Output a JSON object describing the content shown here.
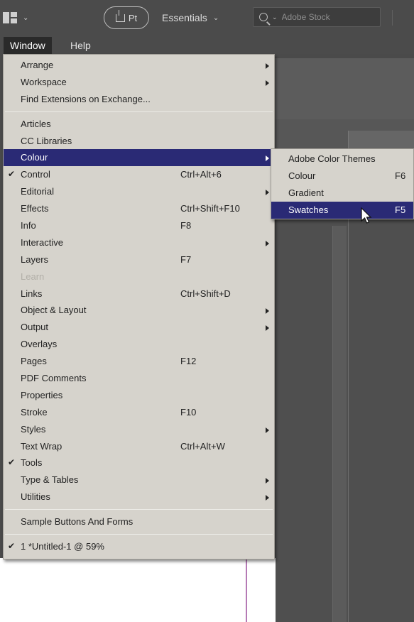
{
  "topbar": {
    "publish_label": "Pt",
    "workspace_label": "Essentials",
    "search_placeholder": "Adobe Stock"
  },
  "menubar": {
    "items": [
      {
        "label": "Window",
        "open": true
      },
      {
        "label": "Help",
        "open": false
      }
    ]
  },
  "window_menu": {
    "group1": [
      {
        "label": "Arrange",
        "submenu": true
      },
      {
        "label": "Workspace",
        "submenu": true
      },
      {
        "label": "Find Extensions on Exchange..."
      }
    ],
    "group2": [
      {
        "label": "Articles"
      },
      {
        "label": "CC Libraries"
      },
      {
        "label": "Colour",
        "submenu": true,
        "highlighted": true
      },
      {
        "label": "Control",
        "shortcut": "Ctrl+Alt+6",
        "checked": true
      },
      {
        "label": "Editorial",
        "submenu": true
      },
      {
        "label": "Effects",
        "shortcut": "Ctrl+Shift+F10"
      },
      {
        "label": "Info",
        "shortcut": "F8"
      },
      {
        "label": "Interactive",
        "submenu": true
      },
      {
        "label": "Layers",
        "shortcut": "F7"
      },
      {
        "label": "Learn",
        "disabled": true
      },
      {
        "label": "Links",
        "shortcut": "Ctrl+Shift+D"
      },
      {
        "label": "Object & Layout",
        "submenu": true
      },
      {
        "label": "Output",
        "submenu": true
      },
      {
        "label": "Overlays"
      },
      {
        "label": "Pages",
        "shortcut": "F12"
      },
      {
        "label": "PDF Comments"
      },
      {
        "label": "Properties"
      },
      {
        "label": "Stroke",
        "shortcut": "F10"
      },
      {
        "label": "Styles",
        "submenu": true
      },
      {
        "label": "Text Wrap",
        "shortcut": "Ctrl+Alt+W"
      },
      {
        "label": "Tools",
        "checked": true
      },
      {
        "label": "Type & Tables",
        "submenu": true
      },
      {
        "label": "Utilities",
        "submenu": true
      }
    ],
    "group3": [
      {
        "label": "Sample Buttons And Forms"
      }
    ],
    "group4": [
      {
        "label": "1 *Untitled-1 @ 59%",
        "checked": true
      }
    ]
  },
  "colour_submenu": [
    {
      "label": "Adobe Color Themes"
    },
    {
      "label": "Colour",
      "shortcut": "F6"
    },
    {
      "label": "Gradient"
    },
    {
      "label": "Swatches",
      "shortcut": "F5",
      "highlighted": true
    }
  ],
  "colors": {
    "menu_bg": "#d6d3cc",
    "highlight": "#2a2a75",
    "app_bg": "#4b4b4b"
  }
}
